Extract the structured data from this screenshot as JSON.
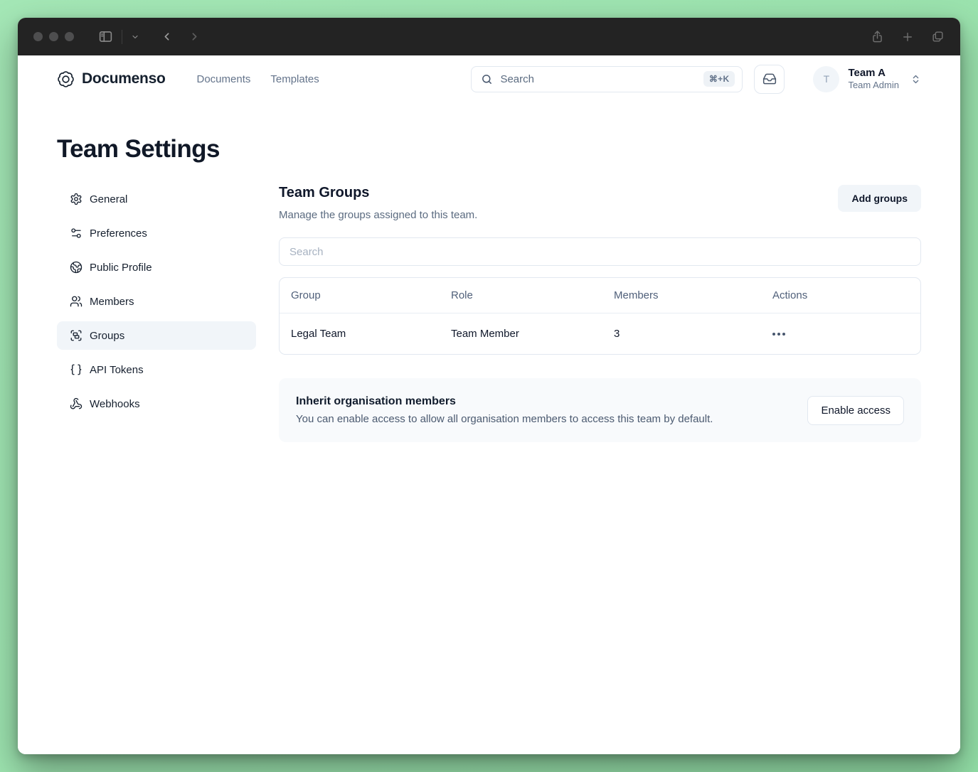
{
  "colors": {
    "desktop_background": "#9ae2ad",
    "titlebar": "#232323",
    "text_dark": "#0f172a",
    "text_muted": "#64748b",
    "border": "#e2e8f0",
    "selected_bg": "#f1f5f9",
    "card_bg": "#f8fafc"
  },
  "header": {
    "logo_text": "Documenso",
    "nav": [
      {
        "label": "Documents"
      },
      {
        "label": "Templates"
      }
    ],
    "search": {
      "placeholder": "Search",
      "shortcut": "⌘+K"
    },
    "account": {
      "initial": "T",
      "name": "Team A",
      "role": "Team Admin"
    }
  },
  "page": {
    "title": "Team Settings"
  },
  "sidebar": {
    "items": [
      {
        "label": "General",
        "icon": "gear",
        "active": false
      },
      {
        "label": "Preferences",
        "icon": "sliders",
        "active": false
      },
      {
        "label": "Public Profile",
        "icon": "globe",
        "active": false
      },
      {
        "label": "Members",
        "icon": "users",
        "active": false
      },
      {
        "label": "Groups",
        "icon": "group-frame",
        "active": true
      },
      {
        "label": "API Tokens",
        "icon": "braces",
        "active": false
      },
      {
        "label": "Webhooks",
        "icon": "webhook",
        "active": false
      }
    ]
  },
  "main": {
    "section_title": "Team Groups",
    "section_subtitle": "Manage the groups assigned to this team.",
    "add_button_label": "Add groups",
    "filter_placeholder": "Search",
    "table": {
      "columns": [
        "Group",
        "Role",
        "Members",
        "Actions"
      ],
      "rows": [
        {
          "group": "Legal Team",
          "role": "Team Member",
          "members": "3"
        }
      ]
    },
    "inherit_card": {
      "title": "Inherit organisation members",
      "description": "You can enable access to allow all organisation members to access this team by default.",
      "button_label": "Enable access"
    }
  }
}
